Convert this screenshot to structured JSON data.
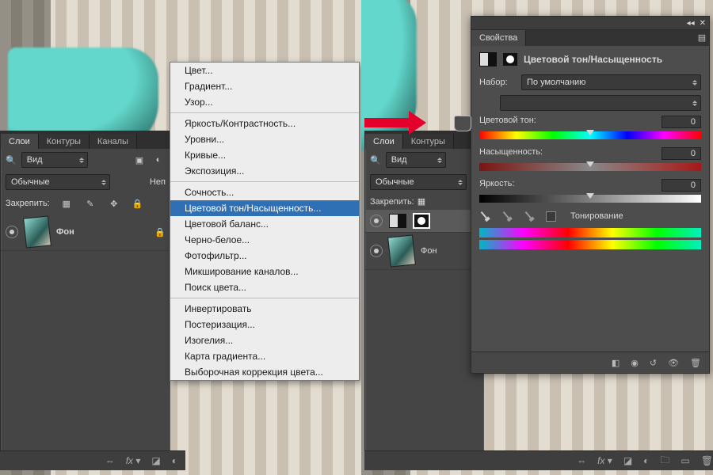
{
  "left": {
    "tabs": [
      "Слои",
      "Контуры",
      "Каналы"
    ],
    "view_select": "Вид",
    "blend_select": "Обычные",
    "opacity_cut": "Неп",
    "lock_label": "Закрепить:",
    "layer_name": "Фон",
    "menu": {
      "group1": [
        "Цвет...",
        "Градиент...",
        "Узор..."
      ],
      "group2": [
        "Яркость/Контрастность...",
        "Уровни...",
        "Кривые...",
        "Экспозиция..."
      ],
      "group3": [
        "Сочность...",
        "Цветовой тон/Насыщенность...",
        "Цветовой баланс...",
        "Черно-белое...",
        "Фотофильтр...",
        "Микширование каналов...",
        "Поиск цвета..."
      ],
      "group4": [
        "Инвертировать",
        "Постеризация...",
        "Изогелия...",
        "Карта градиента...",
        "Выборочная коррекция цвета..."
      ],
      "selected": "Цветовой тон/Насыщенность..."
    }
  },
  "right": {
    "tabs": [
      "Слои",
      "Контуры"
    ],
    "view_select": "Вид",
    "blend_select": "Обычные",
    "lock_label": "Закрепить:",
    "layer_bg": "Фон",
    "properties": {
      "tab": "Свойства",
      "title": "Цветовой тон/Насыщенность",
      "preset_label": "Набор:",
      "preset_value": "По умолчанию",
      "hue_label": "Цветовой тон:",
      "hue_value": "0",
      "sat_label": "Насыщенность:",
      "sat_value": "0",
      "light_label": "Яркость:",
      "light_value": "0",
      "colorize_label": "Тонирование"
    }
  },
  "bottom_icons": [
    "⇔",
    "fx ▾",
    "◪",
    "◐",
    "▭",
    "🗑"
  ]
}
